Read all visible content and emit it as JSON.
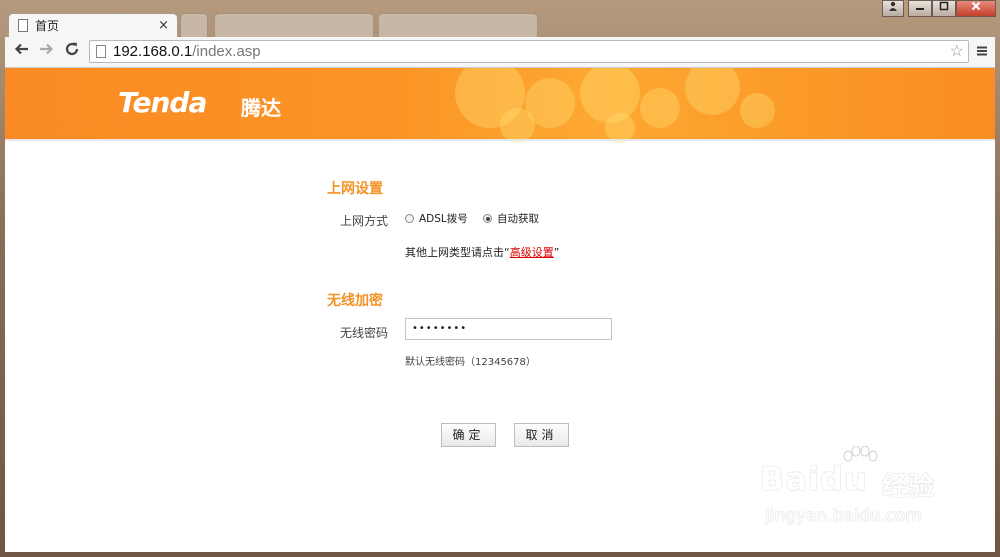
{
  "browser": {
    "active_tab": {
      "title": "首页",
      "close": "×"
    },
    "url_host": "192.168.0.1",
    "url_path": "/index.asp"
  },
  "icons": {
    "back": "arrow-left-icon",
    "forward": "arrow-right-icon",
    "reload": "reload-icon",
    "star": "star-icon",
    "menu": "hamburger-menu-icon"
  },
  "header": {
    "logo": "Tenda",
    "logo_cn": "腾达"
  },
  "internet": {
    "section_title": "上网设置",
    "mode_label": "上网方式",
    "options": [
      {
        "label": "ADSL拨号",
        "selected": false
      },
      {
        "label": "自动获取",
        "selected": true
      }
    ],
    "hint_prefix": "其他上网类型请点击“",
    "hint_link": "高级设置",
    "hint_suffix": "”"
  },
  "wireless": {
    "section_title": "无线加密",
    "password_label": "无线密码",
    "password_value": "••••••••",
    "password_hint": "默认无线密码（12345678）"
  },
  "buttons": {
    "ok": "确定",
    "cancel": "取消"
  },
  "watermark": {
    "brand": "Bai",
    "brand2": "du",
    "cn": "经验",
    "sub": "jingyan.baidu.com"
  },
  "colors": {
    "banner_orange": "#f98a24",
    "section_orange": "#f39325",
    "link_red": "#d00000"
  }
}
